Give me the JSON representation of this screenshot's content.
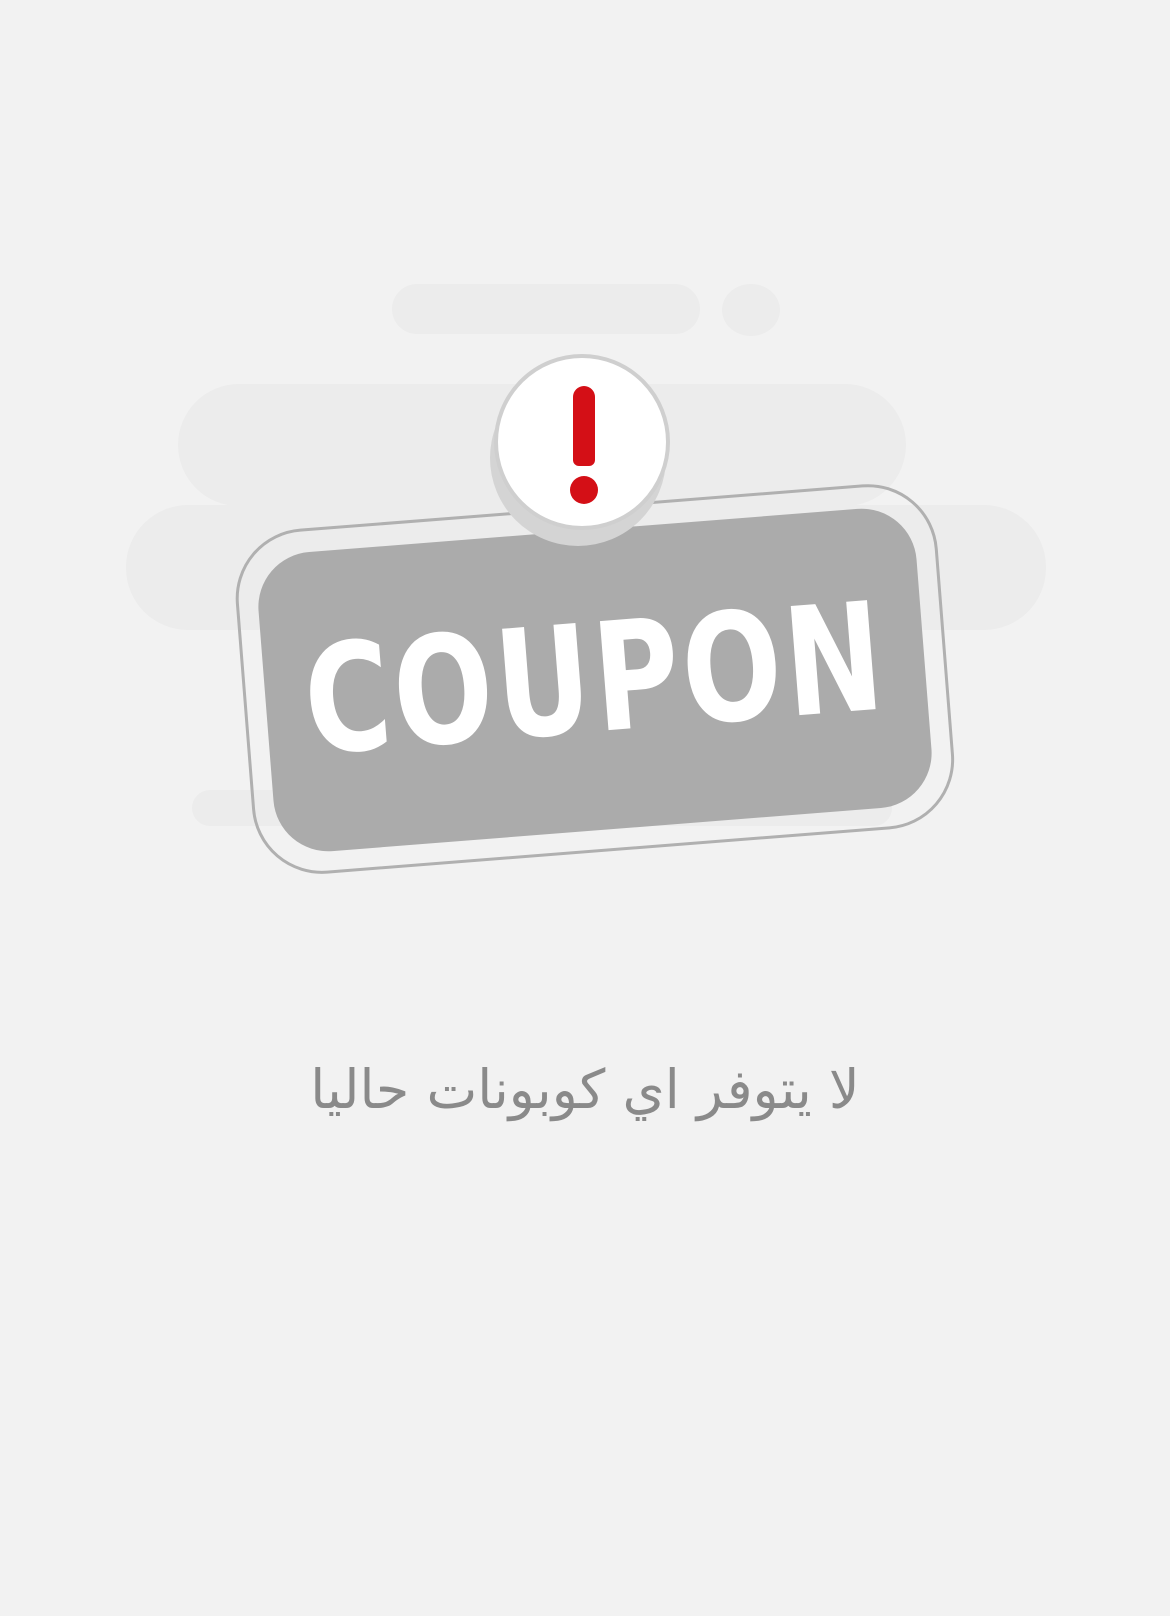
{
  "empty_state": {
    "illustration": {
      "stamp_label": "COUPON",
      "alert_icon": "exclamation-circle-icon",
      "stamp_color": "#ababab",
      "alert_color": "#d40f16"
    },
    "message": "لا يتوفر اي كوبونات حاليا"
  }
}
